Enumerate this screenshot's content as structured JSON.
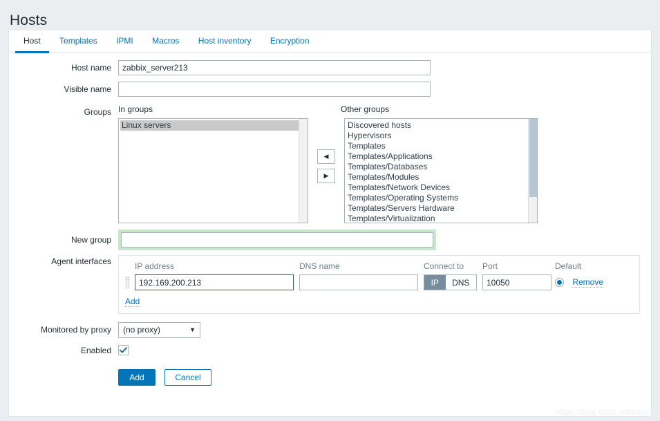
{
  "page": {
    "title": "Hosts"
  },
  "tabs": [
    {
      "label": "Host",
      "active": true
    },
    {
      "label": "Templates",
      "active": false
    },
    {
      "label": "IPMI",
      "active": false
    },
    {
      "label": "Macros",
      "active": false
    },
    {
      "label": "Host inventory",
      "active": false
    },
    {
      "label": "Encryption",
      "active": false
    }
  ],
  "form": {
    "host_name": {
      "label": "Host name",
      "value": "zabbix_server213",
      "placeholder": ""
    },
    "visible_name": {
      "label": "Visible name",
      "value": "",
      "placeholder": ""
    },
    "groups": {
      "label": "Groups",
      "in_groups_header": "In groups",
      "other_groups_header": "Other groups",
      "in_groups": [
        {
          "label": "Linux servers",
          "selected": true
        }
      ],
      "other_groups": [
        {
          "label": "Discovered hosts",
          "selected": false
        },
        {
          "label": "Hypervisors",
          "selected": false
        },
        {
          "label": "Templates",
          "selected": false
        },
        {
          "label": "Templates/Applications",
          "selected": false
        },
        {
          "label": "Templates/Databases",
          "selected": false
        },
        {
          "label": "Templates/Modules",
          "selected": false
        },
        {
          "label": "Templates/Network Devices",
          "selected": false
        },
        {
          "label": "Templates/Operating Systems",
          "selected": false
        },
        {
          "label": "Templates/Servers Hardware",
          "selected": false
        },
        {
          "label": "Templates/Virtualization",
          "selected": false
        }
      ],
      "move_left_icon": "triangle-left-icon",
      "move_right_icon": "triangle-right-icon"
    },
    "new_group": {
      "label": "New group",
      "value": "",
      "placeholder": "",
      "focused": true
    },
    "agent_interfaces": {
      "label": "Agent interfaces",
      "columns": {
        "ip": "IP address",
        "dns": "DNS name",
        "connect_to": "Connect to",
        "port": "Port",
        "default": "Default"
      },
      "rows": [
        {
          "ip": "192.169.200.213",
          "dns": "",
          "connect_to": "IP",
          "connect_options": [
            "IP",
            "DNS"
          ],
          "port": "10050",
          "default_selected": true,
          "remove_label": "Remove"
        }
      ],
      "add_label": "Add"
    },
    "monitored_by_proxy": {
      "label": "Monitored by proxy",
      "value": "(no proxy)"
    },
    "enabled": {
      "label": "Enabled",
      "checked": true
    }
  },
  "actions": {
    "submit_label": "Add",
    "cancel_label": "Cancel"
  },
  "watermark": "https://blog.csdn.net/sayyy",
  "colors": {
    "accent": "#0275b8",
    "page_bg": "#eaeef1",
    "card_bg": "#ffffff",
    "focus_green": "#c8e6c9",
    "selected_gray": "#c9c9c9",
    "toggle_on": "#768d9e",
    "scrollbar_thumb": "#b4c6d3"
  }
}
